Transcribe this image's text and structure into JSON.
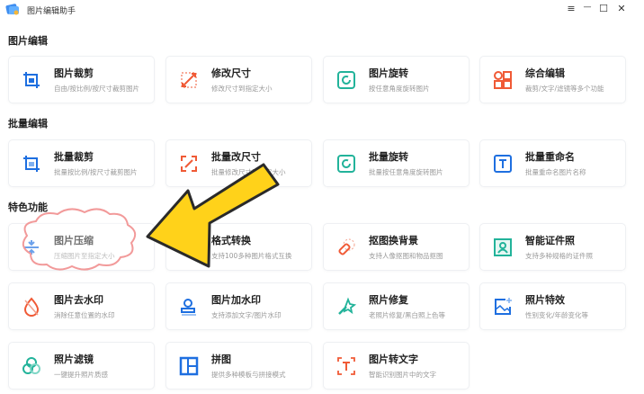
{
  "app": {
    "title": "图片编辑助手"
  },
  "window_controls": {
    "menu": "≡",
    "minimize": "—",
    "maximize": "☐",
    "close": "✕"
  },
  "sections": [
    {
      "title": "图片编辑",
      "items": [
        {
          "title": "图片裁剪",
          "desc": "自由/按比例/按尺寸裁剪图片",
          "icon": "crop-icon"
        },
        {
          "title": "修改尺寸",
          "desc": "修改尺寸到指定大小",
          "icon": "resize-icon"
        },
        {
          "title": "图片旋转",
          "desc": "按任意角度旋转图片",
          "icon": "rotate-icon"
        },
        {
          "title": "综合编辑",
          "desc": "裁剪/文字/滤镜等多个功能",
          "icon": "grid-edit-icon"
        }
      ]
    },
    {
      "title": "批量编辑",
      "items": [
        {
          "title": "批量裁剪",
          "desc": "批量按比例/按尺寸裁剪图片",
          "icon": "batch-crop-icon"
        },
        {
          "title": "批量改尺寸",
          "desc": "批量修改尺寸到指定大小",
          "icon": "batch-resize-icon"
        },
        {
          "title": "批量旋转",
          "desc": "批量按任意角度旋转图片",
          "icon": "batch-rotate-icon"
        },
        {
          "title": "批量重命名",
          "desc": "批量重命名图片名称",
          "icon": "rename-icon"
        }
      ]
    },
    {
      "title": "特色功能",
      "items": [
        {
          "title": "图片压缩",
          "desc": "压缩图片至指定大小",
          "icon": "compress-icon"
        },
        {
          "title": "格式转换",
          "desc": "支持100多种图片格式互换",
          "icon": "convert-icon"
        },
        {
          "title": "抠图换背景",
          "desc": "支持人像抠图和物品抠图",
          "icon": "cutout-icon"
        },
        {
          "title": "智能证件照",
          "desc": "支持多种规格的证件照",
          "icon": "id-photo-icon"
        },
        {
          "title": "图片去水印",
          "desc": "消除任意位置的水印",
          "icon": "remove-watermark-icon"
        },
        {
          "title": "图片加水印",
          "desc": "支持添加文字/图片水印",
          "icon": "add-watermark-icon"
        },
        {
          "title": "照片修复",
          "desc": "老照片修复/黑白照上色等",
          "icon": "magic-wand-icon"
        },
        {
          "title": "照片特效",
          "desc": "性别变化/年龄变化等",
          "icon": "effects-icon"
        },
        {
          "title": "照片滤镜",
          "desc": "一键提升照片质感",
          "icon": "filter-icon"
        },
        {
          "title": "拼图",
          "desc": "提供多种模板与拼接模式",
          "icon": "collage-icon"
        },
        {
          "title": "图片转文字",
          "desc": "智能识别图片中的文字",
          "icon": "ocr-icon"
        }
      ]
    }
  ],
  "colors": {
    "blue": "#1e6fe0",
    "orange": "#f05a36",
    "teal": "#22b39a",
    "arrow": "#ffd21a",
    "cloud": "#f29a9a"
  }
}
